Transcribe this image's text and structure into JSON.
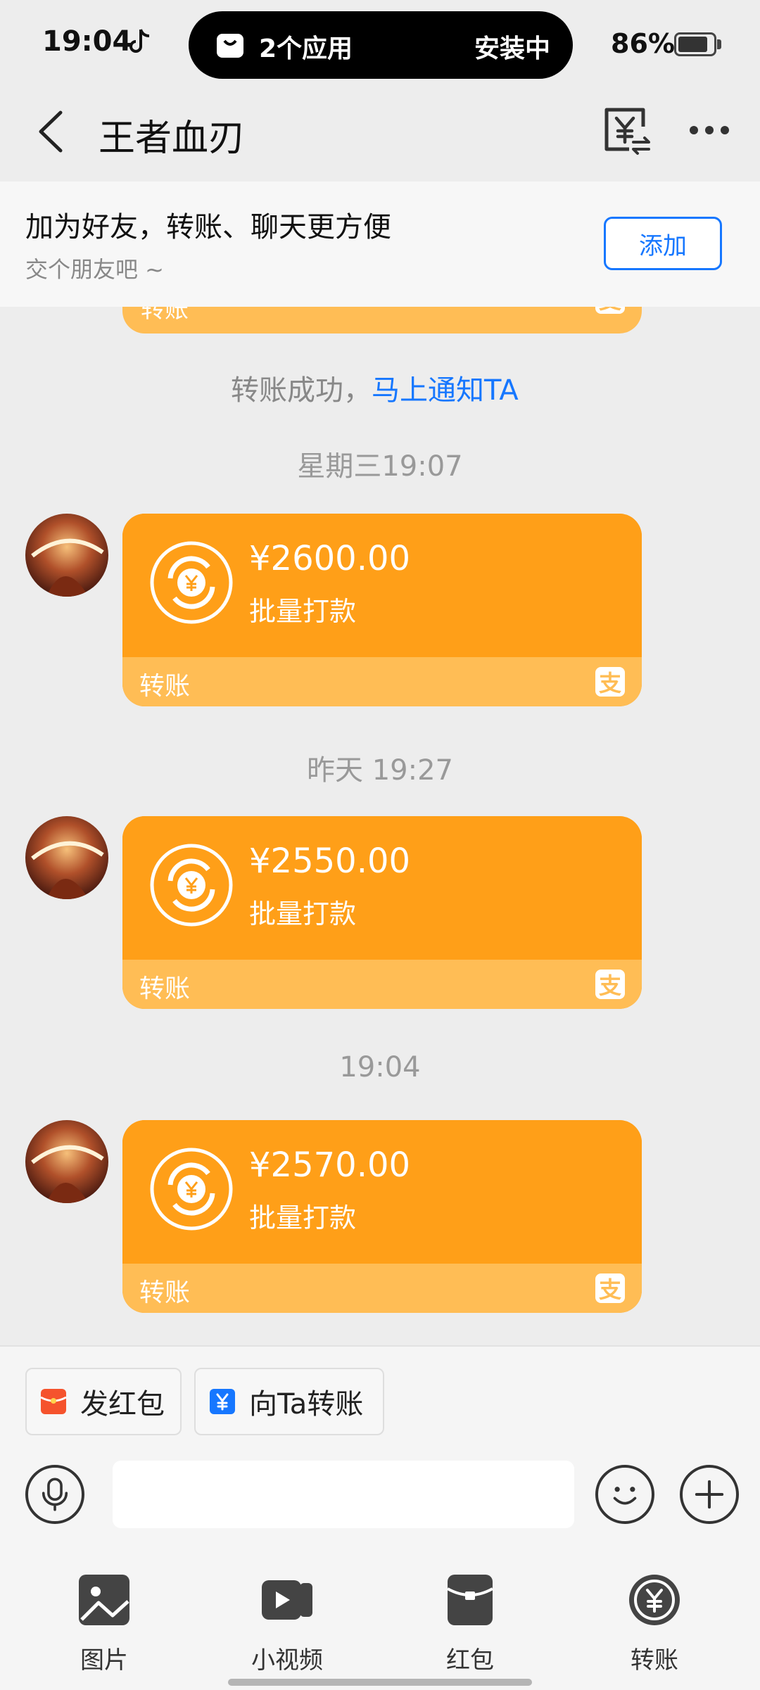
{
  "status_bar": {
    "time": "19:04",
    "island_apps": "2个应用",
    "island_status": "安装中",
    "battery_percent": "86%",
    "battery_level": 0.86
  },
  "nav": {
    "title": "王者血刃"
  },
  "friend_banner": {
    "title": "加为好友，转账、聊天更方便",
    "subtitle": "交个朋友吧 ~",
    "add_label": "添加"
  },
  "partial_card": {
    "label": "转账"
  },
  "notice": {
    "text": "转账成功，",
    "link": "马上通知TA"
  },
  "messages": [
    {
      "timestamp": "星期三19:07",
      "amount": "¥2600.00",
      "memo": "批量打款",
      "label": "转账"
    },
    {
      "timestamp": "昨天 19:27",
      "amount": "¥2550.00",
      "memo": "批量打款",
      "label": "转账"
    },
    {
      "timestamp": "19:04",
      "amount": "¥2570.00",
      "memo": "批量打款",
      "label": "转账"
    }
  ],
  "quick_actions": {
    "red_packet": "发红包",
    "transfer": "向Ta转账"
  },
  "input": {
    "placeholder": ""
  },
  "tools": [
    {
      "label": "图片",
      "icon": "image-icon"
    },
    {
      "label": "小视频",
      "icon": "video-icon"
    },
    {
      "label": "红包",
      "icon": "red-packet-icon"
    },
    {
      "label": "转账",
      "icon": "transfer-icon"
    }
  ],
  "colors": {
    "card_orange": "#ff9f18",
    "card_light_orange": "#ffbd55",
    "link_blue": "#1677ff",
    "background": "#ededed"
  }
}
